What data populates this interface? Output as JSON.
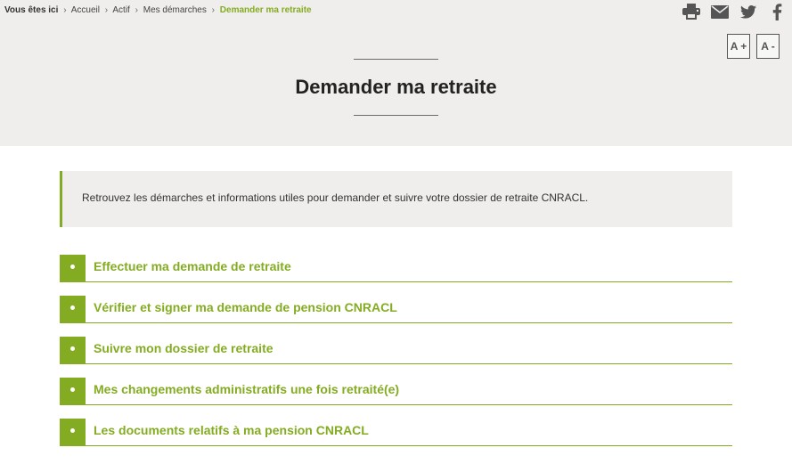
{
  "breadcrumb": {
    "lead": "Vous êtes ici",
    "separator": "›",
    "items": [
      "Accueil",
      "Actif",
      "Mes démarches"
    ],
    "current": "Demander ma retraite"
  },
  "share": {
    "icons": [
      "print-icon",
      "email-icon",
      "twitter-icon",
      "facebook-icon"
    ]
  },
  "font_size": {
    "increase_label": "A +",
    "decrease_label": "A -"
  },
  "page": {
    "title": "Demander ma retraite",
    "intro": "Retrouvez les démarches et informations utiles pour demander et suivre votre dossier de retraite CNRACL."
  },
  "links": [
    {
      "label": "Effectuer ma demande de retraite"
    },
    {
      "label": "Vérifier et signer ma demande de pension CNRACL"
    },
    {
      "label": "Suivre mon dossier de retraite"
    },
    {
      "label": "Mes changements administratifs une fois retraité(e)"
    },
    {
      "label": "Les documents relatifs à ma pension CNRACL"
    }
  ],
  "colors": {
    "accent": "#84ac22",
    "hero_background": "#efeeec",
    "text": "#333333",
    "icon": "#555555"
  }
}
